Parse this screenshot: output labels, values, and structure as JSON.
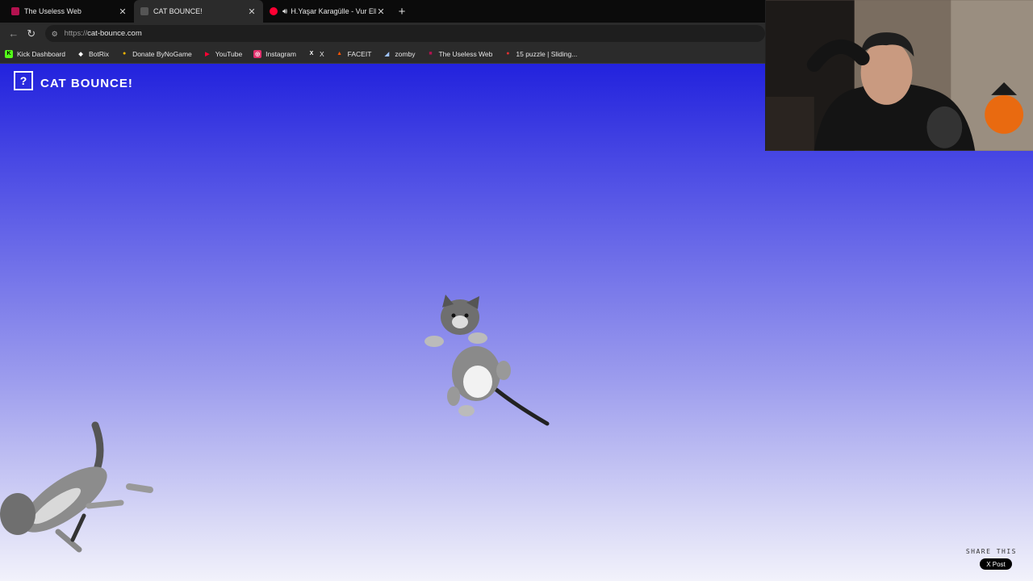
{
  "browser": {
    "tabs": [
      {
        "title": "The Useless Web",
        "favicon_color": "#b3124f",
        "active": false
      },
      {
        "title": "CAT BOUNCE!",
        "favicon_color": "#555555",
        "active": true
      },
      {
        "title": "H.Yaşar Karagülle - Vur Elleri",
        "favicon_color": "#ff0033",
        "active": false
      }
    ],
    "url_scheme": "https://",
    "url_host": "cat-bounce.com",
    "bookmarks": [
      {
        "label": "Kick Dashboard",
        "icon": "K",
        "color": "#53fc18"
      },
      {
        "label": "BotRix",
        "icon": "◆",
        "color": "#ffffff"
      },
      {
        "label": "Donate ByNoGame",
        "icon": "●",
        "color": "#f5b400"
      },
      {
        "label": "YouTube",
        "icon": "▶",
        "color": "#ff0033"
      },
      {
        "label": "Instagram",
        "icon": "◎",
        "color": "#e1306c"
      },
      {
        "label": "X",
        "icon": "X",
        "color": "#ffffff"
      },
      {
        "label": "FACEIT",
        "icon": "▲",
        "color": "#ff5500"
      },
      {
        "label": "zomby",
        "icon": "◢",
        "color": "#9fc4ff"
      },
      {
        "label": "The Useless Web",
        "icon": "■",
        "color": "#b3124f"
      },
      {
        "label": "15 puzzle | Sliding...",
        "icon": "●",
        "color": "#e03030"
      }
    ]
  },
  "page": {
    "help_icon": "?",
    "title": "CAT BOUNCE!",
    "share_label": "SHARE THIS",
    "post_button": "X Post"
  }
}
